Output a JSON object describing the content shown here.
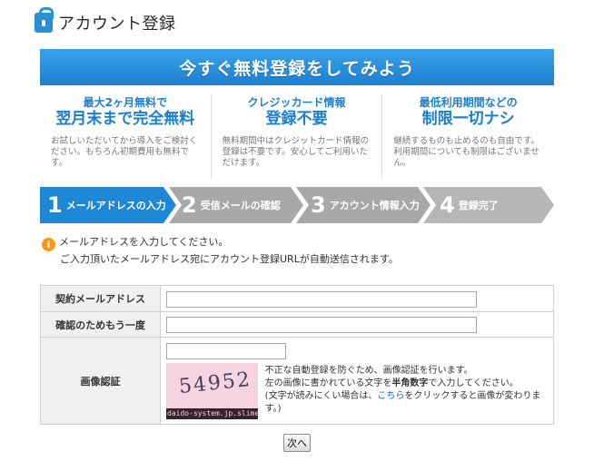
{
  "header": {
    "title": "アカウント登録",
    "icon": "lock-icon"
  },
  "banner": {
    "text": "今すぐ無料登録をしてみよう"
  },
  "features": [
    {
      "sub": "最大2ヶ月無料で",
      "main": "翌月末まで完全無料",
      "desc": "お試しいただいてから導入をご検討ください。もちろん初期費用も無料です。"
    },
    {
      "sub": "クレジッカード情報",
      "main": "登録不要",
      "desc": "無料期間中はクレジットカード情報の登録は不要です。安心してご利用いただけます。"
    },
    {
      "sub": "最低利用期間などの",
      "main": "制限一切ナシ",
      "desc": "継続するものも止めるのも自由です。利用期間についても制限はございません。"
    }
  ],
  "steps": [
    {
      "num": "1",
      "label": "メールアドレスの入力",
      "active": true
    },
    {
      "num": "2",
      "label": "受信メールの確認",
      "active": false
    },
    {
      "num": "3",
      "label": "アカウント情報入力",
      "active": false
    },
    {
      "num": "4",
      "label": "登録完了",
      "active": false
    }
  ],
  "colors": {
    "accent": "#1c7fcf",
    "step_active": "#1e88d6",
    "step_inactive": "#a8a8a8",
    "info": "#f39a1c"
  },
  "notice": {
    "line1": "メールアドレスを入力してください。",
    "line2": "ご入力頂いたメールアドレス宛にアカウント登録URLが自動送信されます。"
  },
  "form": {
    "email_label": "契約メールアドレス",
    "email_value": "",
    "confirm_label": "確認のためもう一度",
    "confirm_value": "",
    "captcha_label": "画像認証",
    "captcha_value": "",
    "captcha_code": "54952",
    "captcha_source": "daido-system.jp.slime",
    "captcha_note1": "不正な自動登録を防ぐため、画像認証を行います。",
    "captcha_note2_pre": "左の画像に書かれている文字を",
    "captcha_note2_bold": "半角数字",
    "captcha_note2_post": "で入力してください。",
    "captcha_note3_pre": "(文字が読みにくい場合は、",
    "captcha_note3_link": "こちら",
    "captcha_note3_post": "をクリックすると画像が変わります。)"
  },
  "buttons": {
    "next": "次へ"
  }
}
